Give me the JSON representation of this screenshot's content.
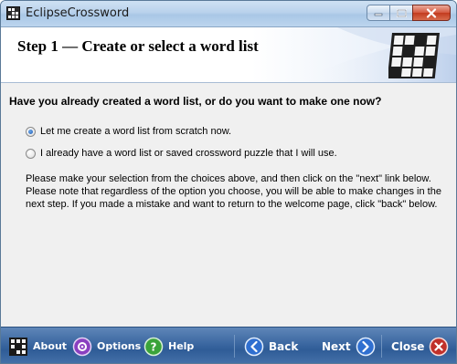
{
  "window": {
    "title": "EclipseCrossword"
  },
  "header": {
    "step_title": "Step 1 — Create or select a word list"
  },
  "content": {
    "question": "Have you already created a word list, or do you want to make one now?",
    "options": [
      {
        "label": "Let me create a word list from scratch now.",
        "checked": true
      },
      {
        "label": "I already have a word list or saved crossword puzzle that I will use.",
        "checked": false
      }
    ],
    "instructions": [
      "Please make your selection from the choices above, and then click on the \"next\" link below.",
      "Please note that regardless of the option you choose, you will be able to make changes in the",
      "next step.  If you made a mistake and want to return to the welcome page, click \"back\" below."
    ]
  },
  "toolbar": {
    "about_label": "About",
    "options_label": "Options",
    "help_label": "Help",
    "back_label": "Back",
    "next_label": "Next",
    "close_label": "Close"
  },
  "colors": {
    "toolbar_bg": "#3e6aa3",
    "options_icon": "#8a3fc0",
    "help_icon": "#3aa33a",
    "nav_icon": "#2f6fd0",
    "close_icon": "#c0302a"
  },
  "icons": {
    "app": "crossword-grid-icon",
    "about": "crossword-grid-icon",
    "options": "options-icon",
    "help": "help-icon",
    "back": "back-arrow-icon",
    "next": "next-arrow-icon",
    "close": "close-x-icon"
  }
}
